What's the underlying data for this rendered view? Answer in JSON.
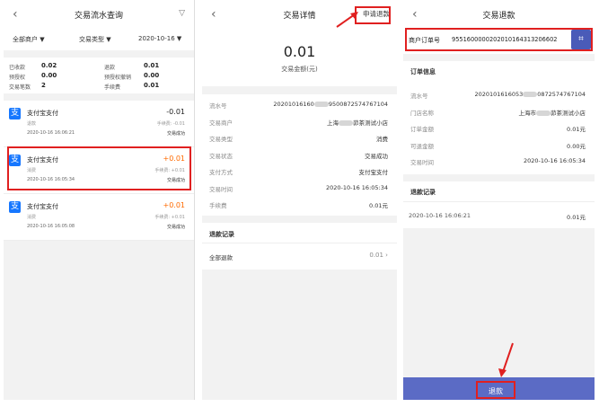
{
  "panel1": {
    "title": "交易流水查询",
    "back_icon": "‹",
    "filter_icon": "▽",
    "filters": {
      "merchant": "全部商户 ▼",
      "type": "交易类型 ▼",
      "date": "2020-10-16 ▼"
    },
    "stats": {
      "received_label": "已收款",
      "received_value": "0.02",
      "refund_label": "退款",
      "refund_value": "0.01",
      "preauth_label": "预授权",
      "preauth_value": "0.00",
      "preauth_cancel_label": "预授权撤销",
      "preauth_cancel_value": "0.00",
      "count_label": "交易笔数",
      "count_value": "2",
      "fee_label": "手续费",
      "fee_value": "0.01"
    },
    "transactions": [
      {
        "logo": "支",
        "name": "支付宝支付",
        "sub": "退款",
        "time": "2020-10-16 16:06:21",
        "amount": "-0.01",
        "fee": "手续费: -0.01",
        "status": "交易成功"
      },
      {
        "logo": "支",
        "name": "支付宝支付",
        "sub": "消费",
        "time": "2020-10-16 16:05:34",
        "amount": "+0.01",
        "fee": "手续费: +0.01",
        "status": "交易成功"
      },
      {
        "logo": "支",
        "name": "支付宝支付",
        "sub": "消费",
        "time": "2020-10-16 16:05:08",
        "amount": "+0.01",
        "fee": "手续费: +0.01",
        "status": "交易成功"
      }
    ]
  },
  "panel2": {
    "title": "交易详情",
    "back_icon": "‹",
    "action": "申请退款",
    "amount": "0.01",
    "amount_caption": "交易金额(元)",
    "details": [
      {
        "k": "流水号",
        "v1": "20201016160",
        "v2": "9500872574767104"
      },
      {
        "k": "交易商户",
        "v1": "上海",
        "v2": "茆茶测试小店"
      },
      {
        "k": "交易类型",
        "v1": "",
        "v2": "消费"
      },
      {
        "k": "交易状态",
        "v1": "",
        "v2": "交易成功"
      },
      {
        "k": "支付方式",
        "v1": "",
        "v2": "支付宝支付"
      },
      {
        "k": "交易时间",
        "v1": "",
        "v2": "2020-10-16 16:05:34"
      },
      {
        "k": "手续费",
        "v1": "",
        "v2": "0.01元"
      }
    ],
    "refund_section": "退款记录",
    "refund_all_label": "全部退款",
    "refund_all_value": "0.01 ›"
  },
  "panel3": {
    "title": "交易退款",
    "back_icon": "‹",
    "order_label": "商户订单号",
    "order_value": "955160000020201016431320660​2",
    "scan_icon": "⌗",
    "order_info_title": "订单信息",
    "info": [
      {
        "k": "流水号",
        "v1": "2020101616053",
        "v2": "0872574767104"
      },
      {
        "k": "门店名称",
        "v1": "上海市",
        "v2": "茆茶测试小店"
      },
      {
        "k": "订单金额",
        "v1": "",
        "v2": "0.01元"
      },
      {
        "k": "可退金额",
        "v1": "",
        "v2": "0.00元"
      },
      {
        "k": "交易时间",
        "v1": "",
        "v2": "2020-10-16 16:05:34"
      }
    ],
    "refund_record_title": "退款记录",
    "refund_record_time": "2020-10-16 16:06:21",
    "refund_record_amount": "0.01元",
    "refund_button": "退款"
  },
  "colors": {
    "accent": "#5b6bc5",
    "highlight": "#e02020",
    "positive": "#ff6a00",
    "alipay": "#1677ff"
  }
}
